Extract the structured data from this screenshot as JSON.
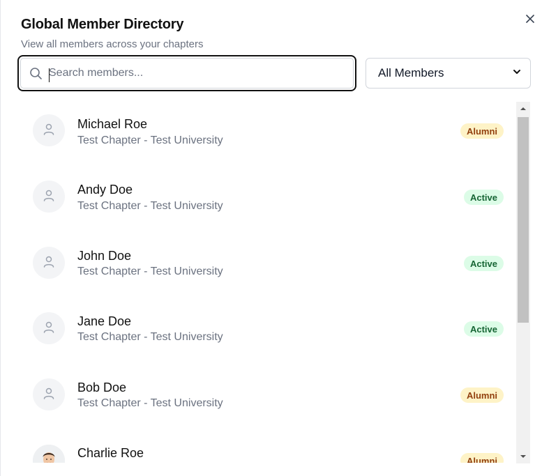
{
  "dialog": {
    "title": "Global Member Directory",
    "subtitle": "View all members across your chapters",
    "close_icon": "close-icon"
  },
  "search": {
    "placeholder": "Search members...",
    "value": "",
    "icon": "search-icon"
  },
  "filter": {
    "selected": "All Members",
    "icon": "chevron-down-icon"
  },
  "members": [
    {
      "name": "Michael Roe",
      "chapter": "Test Chapter - Test University",
      "status": "Alumni",
      "avatar": "user-icon"
    },
    {
      "name": "Andy Doe",
      "chapter": "Test Chapter - Test University",
      "status": "Active",
      "avatar": "user-icon"
    },
    {
      "name": "John Doe",
      "chapter": "Test Chapter - Test University",
      "status": "Active",
      "avatar": "user-icon"
    },
    {
      "name": "Jane Doe",
      "chapter": "Test Chapter - Test University",
      "status": "Active",
      "avatar": "user-icon"
    },
    {
      "name": "Bob Doe",
      "chapter": "Test Chapter - Test University",
      "status": "Alumni",
      "avatar": "user-icon"
    },
    {
      "name": "Charlie Roe",
      "chapter": "",
      "status": "Alumni",
      "avatar": "photo"
    }
  ],
  "colors": {
    "alumni_bg": "#fef3c7",
    "alumni_text": "#92400e",
    "active_bg": "#dcfce7",
    "active_text": "#166534"
  }
}
